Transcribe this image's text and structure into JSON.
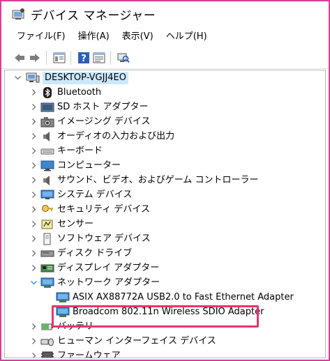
{
  "window": {
    "title": "デバイス マネージャー",
    "icon": "device-manager-icon"
  },
  "menu": [
    {
      "label": "ファイル(F)"
    },
    {
      "label": "操作(A)"
    },
    {
      "label": "表示(V)"
    },
    {
      "label": "ヘルプ(H)"
    }
  ],
  "toolbar": [
    {
      "icon": "back-arrow-icon"
    },
    {
      "icon": "forward-arrow-icon"
    },
    {
      "icon": "properties-icon"
    },
    {
      "icon": "help-icon"
    },
    {
      "icon": "update-driver-icon"
    },
    {
      "icon": "scan-hardware-icon"
    }
  ],
  "tree": {
    "root": {
      "label": "DESKTOP-VGJJ4EO",
      "icon": "computer-icon",
      "expanded": true
    },
    "items": [
      {
        "label": "Bluetooth",
        "icon": "bluetooth-icon",
        "expanded": false
      },
      {
        "label": "SD ホスト アダプター",
        "icon": "sd-host-icon",
        "expanded": false
      },
      {
        "label": "イメージング デバイス",
        "icon": "camera-icon",
        "expanded": false
      },
      {
        "label": "オーディオの入力および出力",
        "icon": "speaker-icon",
        "expanded": false
      },
      {
        "label": "キーボード",
        "icon": "keyboard-icon",
        "expanded": false
      },
      {
        "label": "コンピューター",
        "icon": "monitor-icon",
        "expanded": false
      },
      {
        "label": "サウンド、ビデオ、およびゲーム コントローラー",
        "icon": "speaker-icon",
        "expanded": false
      },
      {
        "label": "システム デバイス",
        "icon": "system-device-icon",
        "expanded": false
      },
      {
        "label": "セキュリティ デバイス",
        "icon": "security-key-icon",
        "expanded": false
      },
      {
        "label": "センサー",
        "icon": "sensor-icon",
        "expanded": false
      },
      {
        "label": "ソフトウェア デバイス",
        "icon": "software-device-icon",
        "expanded": false
      },
      {
        "label": "ディスク ドライブ",
        "icon": "disk-drive-icon",
        "expanded": false
      },
      {
        "label": "ディスプレイ アダプター",
        "icon": "display-adapter-icon",
        "expanded": false
      },
      {
        "label": "ネットワーク アダプター",
        "icon": "network-adapter-icon",
        "expanded": true,
        "children": [
          {
            "label": "ASIX AX88772A USB2.0 to Fast Ethernet Adapter",
            "icon": "network-adapter-icon"
          },
          {
            "label": "Broadcom 802.11n Wireless SDIO Adapter",
            "icon": "network-adapter-icon",
            "highlighted": true
          }
        ]
      },
      {
        "label": "バッテリ",
        "icon": "battery-icon",
        "expanded": false
      },
      {
        "label": "ヒューマン インターフェイス デバイス",
        "icon": "hid-icon",
        "expanded": false
      },
      {
        "label": "ファームウェア",
        "icon": "firmware-icon",
        "expanded": false
      }
    ]
  },
  "colors": {
    "accent_border": "#d43f9a",
    "highlight_border": "#e8346d",
    "root_selection": "#cce8ff",
    "expand_chevron": "#2a8dd4",
    "collapse_chevron": "#6e6e6e"
  }
}
